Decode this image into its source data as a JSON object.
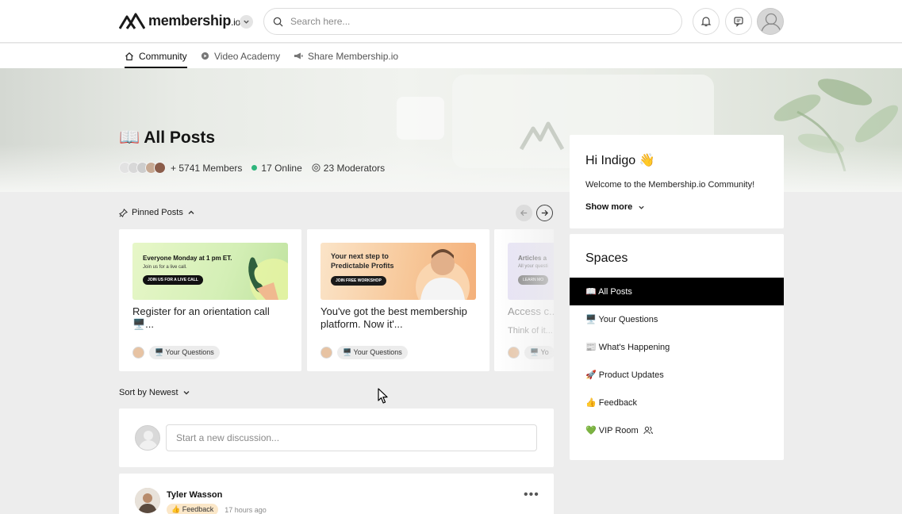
{
  "brand": {
    "name": "membership",
    "suffix": ".io"
  },
  "search": {
    "placeholder": "Search here..."
  },
  "icons": {
    "notifications": "bell-icon",
    "messages": "chat-icon",
    "profile": "user-avatar"
  },
  "nav": {
    "tabs": [
      {
        "label": "Community",
        "icon": "home-icon",
        "active": true
      },
      {
        "label": "Video Academy",
        "icon": "play-circle-icon",
        "active": false
      },
      {
        "label": "Share Membership.io",
        "icon": "megaphone-icon",
        "active": false
      }
    ]
  },
  "hero": {
    "emoji": "📖",
    "title": "All Posts",
    "members": "+ 5741 Members",
    "online": "17 Online",
    "moderators": "23 Moderators"
  },
  "pinned": {
    "label": "Pinned Posts",
    "posts": [
      {
        "thumb_line1": "Everyone Monday at 1 pm ET.",
        "thumb_line2": "Join us for a live call.",
        "thumb_button": "JOIN US FOR A LIVE CALL",
        "title": "Register for an orientation call 🖥️...",
        "chip": "🖥️ Your Questions"
      },
      {
        "thumb_line1": "Your next step to Predictable Profits",
        "thumb_button": "JOIN FREE WORKSHOP",
        "title": "You've got the best membership platform. Now it'...",
        "chip": "🖥️ Your Questions"
      },
      {
        "thumb_line1": "Articles a",
        "thumb_line2": "All your questi",
        "thumb_button": "LEARN MO",
        "title": "Access c...",
        "subtitle": "Think of it...",
        "chip": "🖥️ Yo"
      }
    ]
  },
  "sort": {
    "label": "Sort by Newest"
  },
  "composer": {
    "placeholder": "Start a new discussion..."
  },
  "post": {
    "author": "Tyler Wasson",
    "chip": "👍 Feedback",
    "time": "17 hours ago",
    "more": "•••"
  },
  "welcome": {
    "greeting": "Hi Indigo 👋",
    "message": "Welcome to the Membership.io Community!",
    "show_more": "Show more"
  },
  "spaces": {
    "title": "Spaces",
    "items": [
      {
        "label": "📖 All Posts",
        "active": true
      },
      {
        "label": "🖥️ Your Questions",
        "active": false
      },
      {
        "label": "📰 What's Happening",
        "active": false
      },
      {
        "label": "🚀 Product Updates",
        "active": false
      },
      {
        "label": "👍 Feedback",
        "active": false
      },
      {
        "label": "💚 VIP Room",
        "active": false,
        "icon": "members-icon"
      }
    ]
  },
  "colors": {
    "accent": "#000000",
    "online": "#2fb57c",
    "background": "#ededed"
  }
}
